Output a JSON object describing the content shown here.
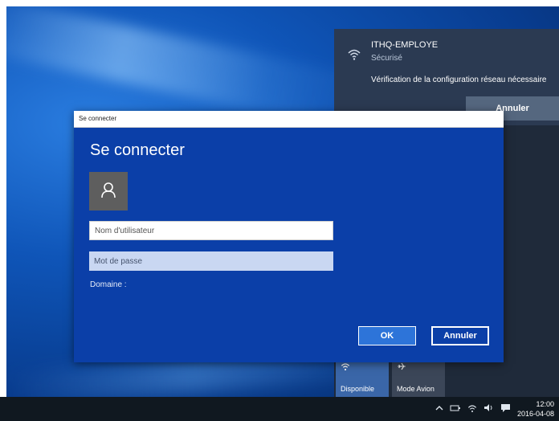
{
  "colors": {
    "desktop": "#0f55b8",
    "dialog_bg": "#0b3fa8",
    "ok_button": "#2d74d9",
    "action_center": "#1f2a3a"
  },
  "notification": {
    "icon": "wifi-icon",
    "network_name": "ITHQ-EMPLOYE",
    "status": "Sécurisé",
    "message": "Vérification de la configuration réseau nécessaire",
    "cancel_label": "Annuler"
  },
  "quick_actions": [
    {
      "icon": "wifi-icon",
      "label": "Disponible"
    },
    {
      "icon": "airplane-icon",
      "label": "Mode Avion"
    }
  ],
  "dialog": {
    "window_title": "Se connecter",
    "heading": "Se connecter",
    "avatar_icon": "user-icon",
    "username_placeholder": "Nom d'utilisateur",
    "password_placeholder": "Mot de passe",
    "domain_label": "Domaine :",
    "ok_label": "OK",
    "cancel_label": "Annuler"
  },
  "taskbar": {
    "tray_icons": [
      "chevron-up-icon",
      "battery-icon",
      "wifi-icon",
      "volume-icon",
      "notification-icon"
    ],
    "time": "12:00",
    "date": "2016-04-08"
  }
}
